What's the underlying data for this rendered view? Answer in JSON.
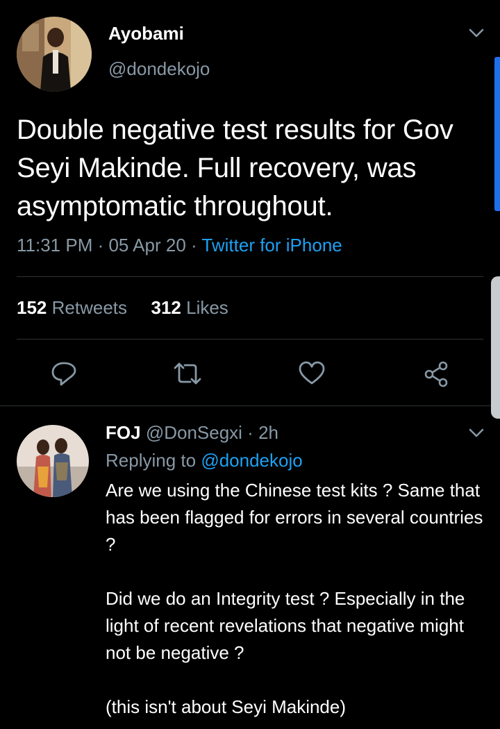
{
  "main_tweet": {
    "author_name": "Ayobami",
    "author_handle": "@dondekojo",
    "text": "Double negative test results for Gov Seyi Makinde. Full recovery, was asymptomatic throughout.",
    "time": "11:31 PM",
    "date": "05 Apr 20",
    "source": "Twitter for iPhone",
    "retweet_count": "152",
    "retweet_label": "Retweets",
    "like_count": "312",
    "like_label": "Likes",
    "actions": [
      "reply-icon",
      "retweet-icon",
      "like-icon",
      "share-icon"
    ]
  },
  "reply": {
    "author_name": "FOJ",
    "author_handle": "@DonSegxi",
    "time_ago": "2h",
    "replying_prefix": "Replying to",
    "replying_to": "@dondekojo",
    "paragraphs": [
      "Are we using the Chinese test kits ? Same that has been flagged for errors in several countries ?",
      "Did we do an Integrity test ? Especially in the light of recent revelations that negative might not be negative ?",
      "(this isn't about Seyi Makinde)"
    ]
  },
  "colors": {
    "background": "#000000",
    "text_primary": "#ffffff",
    "text_secondary": "#8899a6",
    "accent_blue": "#1da1f2",
    "divider": "#2f3336"
  }
}
